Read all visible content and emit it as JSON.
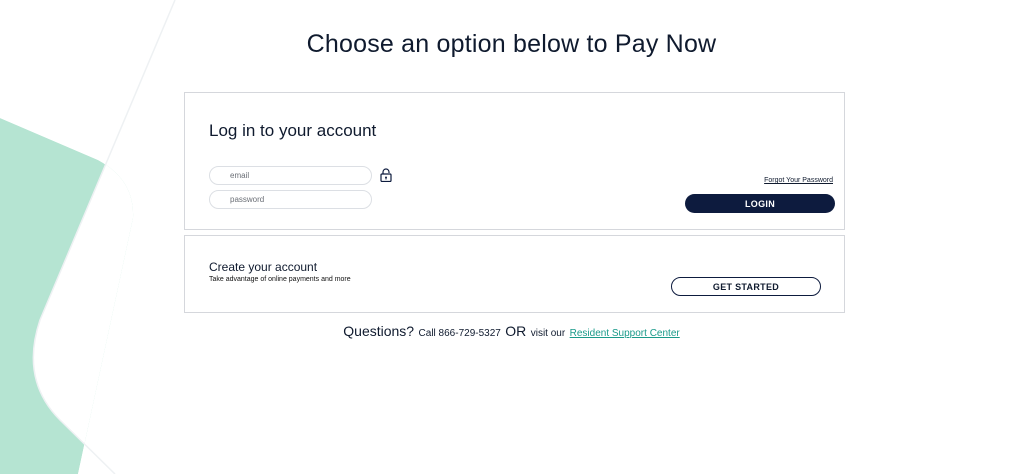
{
  "page": {
    "title": "Choose an option below to Pay Now"
  },
  "colors": {
    "accent_green": "#b5e4d2",
    "navy": "#0d1b3e",
    "link_teal": "#1a9a8a"
  },
  "login": {
    "heading": "Log in to your account",
    "email_placeholder": "email",
    "password_placeholder": "password",
    "lock_icon": "lock-icon",
    "forgot_password": "Forgot Your Password",
    "login_button": "LOGIN"
  },
  "create": {
    "heading": "Create your account",
    "subtext": "Take advantage of online payments and more",
    "get_started_button": "GET STARTED"
  },
  "footer": {
    "questions": "Questions?",
    "call_text": "Call 866-729-5327",
    "or_text": "OR",
    "visit_text": "visit our",
    "support_link": "Resident Support Center"
  }
}
